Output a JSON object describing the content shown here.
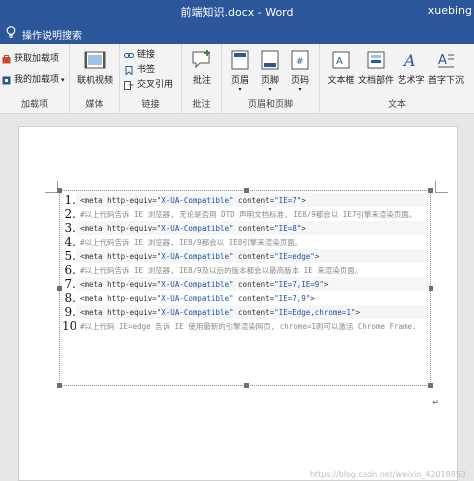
{
  "window": {
    "title": "前端知识.docx - Word",
    "user": "xuebing"
  },
  "tell_me": {
    "label": "操作说明搜索"
  },
  "ribbon": {
    "addins": {
      "get_addins": "获取加载项",
      "my_addins": "我的加载项",
      "group_label": "加载项"
    },
    "media": {
      "online_video": "联机视频",
      "group_label": "媒体"
    },
    "links": {
      "link": "链接",
      "bookmark": "书签",
      "cross_ref": "交叉引用",
      "group_label": "链接"
    },
    "comments": {
      "comment": "批注",
      "group_label": "批注"
    },
    "header_footer": {
      "header": "页眉",
      "footer": "页脚",
      "page_number": "页码",
      "group_label": "页眉和页脚"
    },
    "text": {
      "text_box": "文本框",
      "quick_parts": "文档部件",
      "wordart": "艺术字",
      "drop_cap": "首字下沉",
      "group_label": "文本"
    }
  },
  "document": {
    "code_lines": [
      {
        "num": "1.",
        "kind": "meta",
        "pre": "<meta http-equiv=",
        "equiv": "\"X-UA-Compatible\"",
        "mid": " content=",
        "content": "\"IE=7\"",
        "post": ">"
      },
      {
        "num": "2.",
        "kind": "comment",
        "text": "#以上代码告诉 IE 浏览器, 无论是否用 DTD 声明文档标准, IE8/9都会以 IE7引擎来渲染页面。"
      },
      {
        "num": "3.",
        "kind": "meta",
        "pre": "<meta http-equiv=",
        "equiv": "\"X-UA-Compatible\"",
        "mid": " content=",
        "content": "\"IE=8\"",
        "post": ">"
      },
      {
        "num": "4.",
        "kind": "comment",
        "text": "#以上代码告诉 IE 浏览器, IE8/9都会以 IE8引擎来渲染页面。"
      },
      {
        "num": "5.",
        "kind": "meta",
        "pre": "<meta http-equiv=",
        "equiv": "\"X-UA-Compatible\"",
        "mid": " content=",
        "content": "\"IE=edge\"",
        "post": ">"
      },
      {
        "num": "6.",
        "kind": "comment",
        "text": "#以上代码告诉 IE 浏览器, IE8/9及以后的版本都会以最高版本 IE 来渲染页面。"
      },
      {
        "num": "7.",
        "kind": "meta",
        "pre": "<meta http-equiv=",
        "equiv": "\"X-UA-Compatible\"",
        "mid": " content=",
        "content": "\"IE=7,IE=9\"",
        "post": ">"
      },
      {
        "num": "8.",
        "kind": "meta",
        "pre": "<meta http-equiv=",
        "equiv": "\"X-UA-Compatible\"",
        "mid": " content=",
        "content": "\"IE=7,9\"",
        "post": ">"
      },
      {
        "num": "9.",
        "kind": "meta",
        "pre": "<meta http-equiv=",
        "equiv": "\"X-UA-Compatible\"",
        "mid": " content=",
        "content": "\"IE=Edge,chrome=1\"",
        "post": ">"
      },
      {
        "num": "10.",
        "kind": "comment",
        "text": "#以上代码 IE=edge 告诉 IE 使用最新的引擎渲染网页, chrome=1则可以激活 Chrome Frame."
      }
    ]
  },
  "watermark": "https://blog.csdn.net/weixin_42018853",
  "colors": {
    "titlebar": "#2b579a",
    "string": "#1d4fb8",
    "comment": "#888888"
  }
}
